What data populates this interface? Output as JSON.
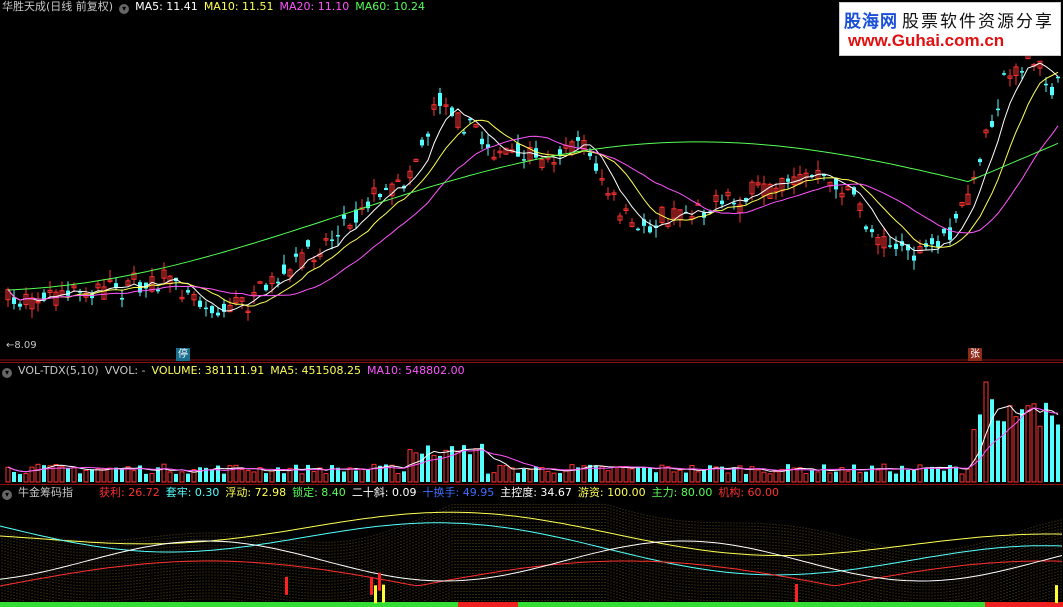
{
  "price": {
    "title": "华胜天成(日线 前复权)",
    "indicators": [
      {
        "label": "MA5: 11.41",
        "color": "#ffffff"
      },
      {
        "label": "MA10: 11.51",
        "color": "#ffff55"
      },
      {
        "label": "MA20: 11.10",
        "color": "#ff55ff"
      },
      {
        "label": "MA60: 10.24",
        "color": "#55ff55"
      }
    ],
    "low_label": "8.09",
    "flag_stop": "停",
    "flag_up": "张"
  },
  "volume": {
    "title": "VOL-TDX(5,10)",
    "vvol": "VVOL: -",
    "indicators": [
      {
        "label": "VOLUME: 381111.91",
        "color": "#ffff55"
      },
      {
        "label": "MA5: 451508.25",
        "color": "#ffff55"
      },
      {
        "label": "MA10: 548802.00",
        "color": "#ff55ff"
      }
    ]
  },
  "indicator": {
    "title": "牛金筹码指",
    "values": [
      {
        "label": "获利: 26.72",
        "color": "#ff3030"
      },
      {
        "label": "套牢: 0.30",
        "color": "#55ffff"
      },
      {
        "label": "浮动: 72.98",
        "color": "#ffff55"
      },
      {
        "label": "锁定: 8.40",
        "color": "#55ff55"
      },
      {
        "label": "二十斜: 0.09",
        "color": "#ffffff"
      },
      {
        "label": "十换手: 49.95",
        "color": "#3d6bff"
      },
      {
        "label": "主控度: 34.67",
        "color": "#ffffff"
      },
      {
        "label": "游资: 100.00",
        "color": "#ffff55"
      },
      {
        "label": "主力: 80.00",
        "color": "#55ff55"
      },
      {
        "label": "机构: 60.00",
        "color": "#ff3030"
      }
    ]
  },
  "watermark": {
    "brand": "股海网",
    "slogan": "股票软件资源分享",
    "url": "www.Guhai.com.cn"
  }
}
